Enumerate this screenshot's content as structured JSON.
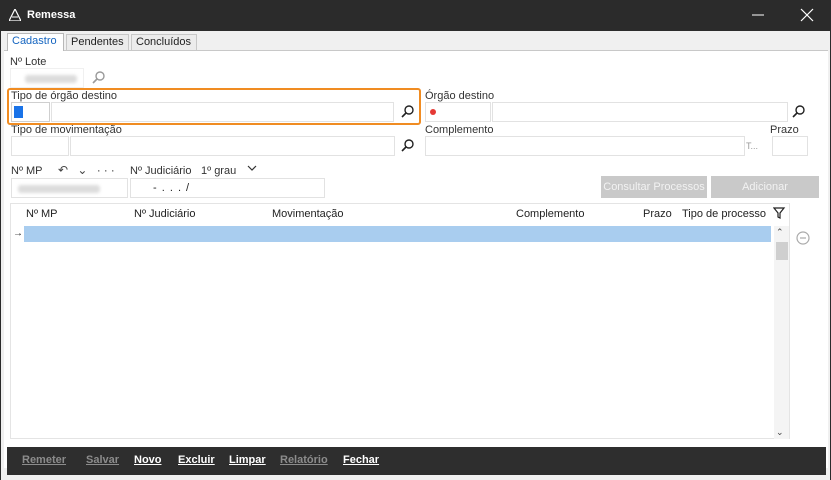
{
  "window": {
    "title": "Remessa",
    "colors": {
      "titlebar": "#2b2b2b",
      "focus": "#f08c22",
      "selection": "#a9cdef",
      "tab_active": "#1565c0"
    }
  },
  "tabs": [
    {
      "label": "Cadastro",
      "active": true
    },
    {
      "label": "Pendentes",
      "active": false
    },
    {
      "label": "Concluídos",
      "active": false
    }
  ],
  "form": {
    "lote_label": "Nº Lote",
    "tipo_orgao_label": "Tipo de órgão destino",
    "orgao_destino_label": "Órgão destino",
    "tipo_mov_label": "Tipo de movimentação",
    "complemento_label": "Complemento",
    "complemento_suffix": "T...",
    "prazo_label": "Prazo",
    "mp_label": "Nº MP",
    "mp_controls": "↶ ⌄ ···",
    "judiciario_label": "Nº Judiciário",
    "grau_label": "1º grau",
    "judiciario_mask": "-    .     .   .   /"
  },
  "buttons": {
    "consultar": "Consultar Processos",
    "adicionar": "Adicionar"
  },
  "grid": {
    "columns": [
      "Nº MP",
      "Nº Judiciário",
      "Movimentação",
      "Complemento",
      "Prazo",
      "Tipo de processo"
    ],
    "row_marker": "→"
  },
  "footer": [
    {
      "label": "Remeter",
      "enabled": false
    },
    {
      "label": "Salvar",
      "enabled": false
    },
    {
      "label": "Novo",
      "enabled": true
    },
    {
      "label": "Excluir",
      "enabled": true
    },
    {
      "label": "Limpar",
      "enabled": true
    },
    {
      "label": "Relatório",
      "enabled": false
    },
    {
      "label": "Fechar",
      "enabled": true
    }
  ]
}
